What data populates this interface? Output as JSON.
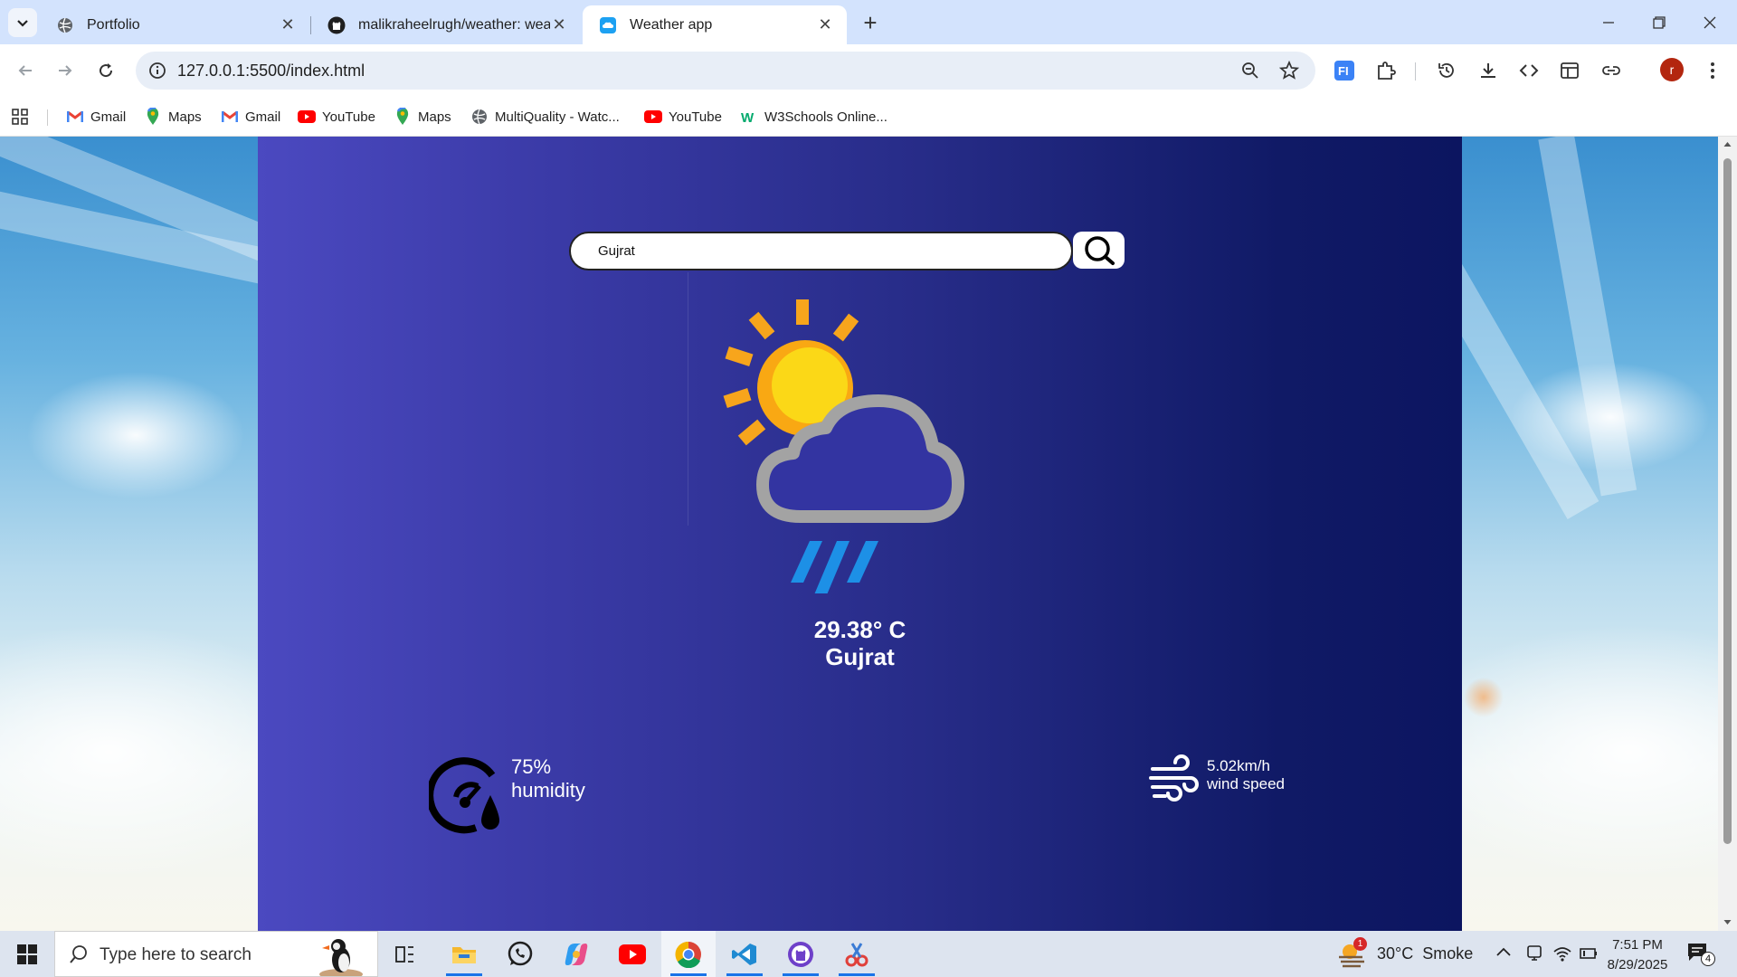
{
  "browser": {
    "tabs": [
      {
        "title": "Portfolio",
        "active": false
      },
      {
        "title": "malikraheelrugh/weather: weat",
        "active": false
      },
      {
        "title": "Weather app",
        "active": true
      }
    ],
    "address": "127.0.0.1:5500/index.html",
    "profile_initial": "r",
    "bookmarks": [
      "Gmail",
      "Maps",
      "Gmail",
      "YouTube",
      "Maps",
      "MultiQuality - Watc...",
      "YouTube",
      "W3Schools Online..."
    ]
  },
  "app": {
    "search_value": "Gujrat",
    "temperature": "29.38° C",
    "city": "Gujrat",
    "weather_icon": "sun-cloud-rain-icon",
    "humidity_value": "75%",
    "humidity_label": "humidity",
    "wind_value": "5.02km/h",
    "wind_label": "wind speed"
  },
  "taskbar": {
    "search_placeholder": "Type here to search",
    "weather_text": "30°C  Smoke",
    "weather_badge": "1",
    "time": "7:51 PM",
    "date": "8/29/2025",
    "notification_count": "4"
  }
}
